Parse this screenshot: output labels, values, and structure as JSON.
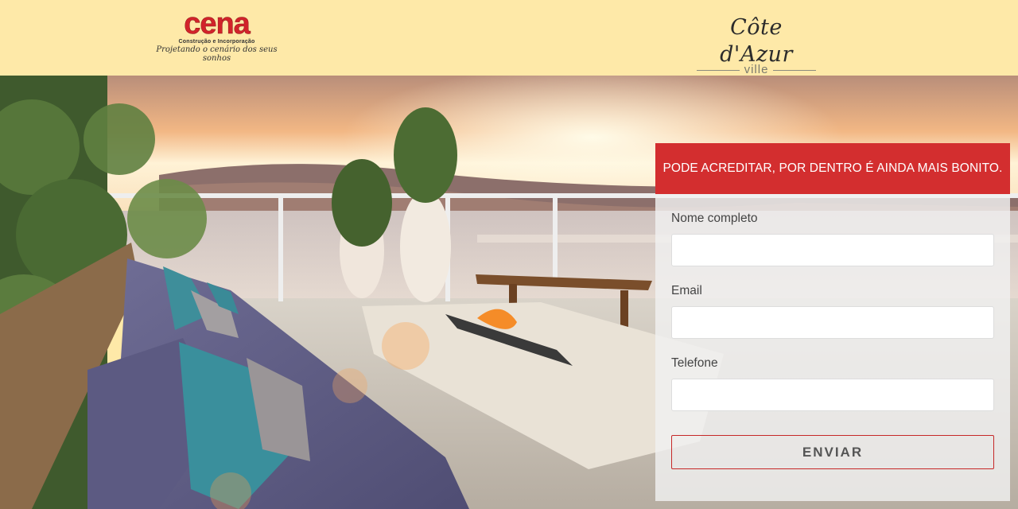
{
  "header": {
    "cena_logo": {
      "name": "cena",
      "subtitle": "Construção e Incorporação",
      "slogan": "Projetando o cenário dos seus sonhos"
    },
    "cote_logo": {
      "name": "Côte d'Azur",
      "suffix": "ville"
    }
  },
  "form": {
    "heading": "PODE ACREDITAR, POR DENTRO É AINDA MAIS BONITO.",
    "fields": [
      {
        "label": "Nome completo",
        "value": ""
      },
      {
        "label": "Email",
        "value": ""
      },
      {
        "label": "Telefone",
        "value": ""
      }
    ],
    "submit_label": "ENVIAR"
  },
  "colors": {
    "header_bg": "#fee9a8",
    "brand_red": "#d32e2f"
  }
}
